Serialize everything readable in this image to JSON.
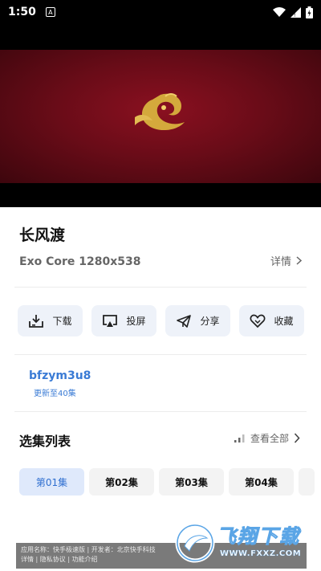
{
  "status_bar": {
    "time": "1:50",
    "notification_icon": "A"
  },
  "video": {
    "title": "长风渡"
  },
  "info": {
    "title": "长风渡",
    "meta": "Exo Core  1280x538",
    "details_label": "详情"
  },
  "actions": [
    {
      "label": "下载",
      "icon": "download-icon"
    },
    {
      "label": "投屏",
      "icon": "cast-icon"
    },
    {
      "label": "分享",
      "icon": "share-icon"
    },
    {
      "label": "收藏",
      "icon": "favorite-icon"
    }
  ],
  "uploader": {
    "name": "bfzym3u8",
    "update": "更新至40集"
  },
  "episodes": {
    "title": "选集列表",
    "view_all": "查看全部",
    "items": [
      "第01集",
      "第02集",
      "第03集",
      "第04集"
    ],
    "selected": "第01集"
  },
  "footer": {
    "line1": "应用名称：快手极速版 | 开发者：北京快手科技",
    "line2": "详情 | 隐私协议 | 功能介绍"
  },
  "watermark": {
    "text": "飞翔下载",
    "url": "WWW.FXXZ.COM"
  },
  "colors": {
    "accent": "#3a7bd5",
    "button_bg": "#eef2f9",
    "video_red": "#6a0c18"
  }
}
